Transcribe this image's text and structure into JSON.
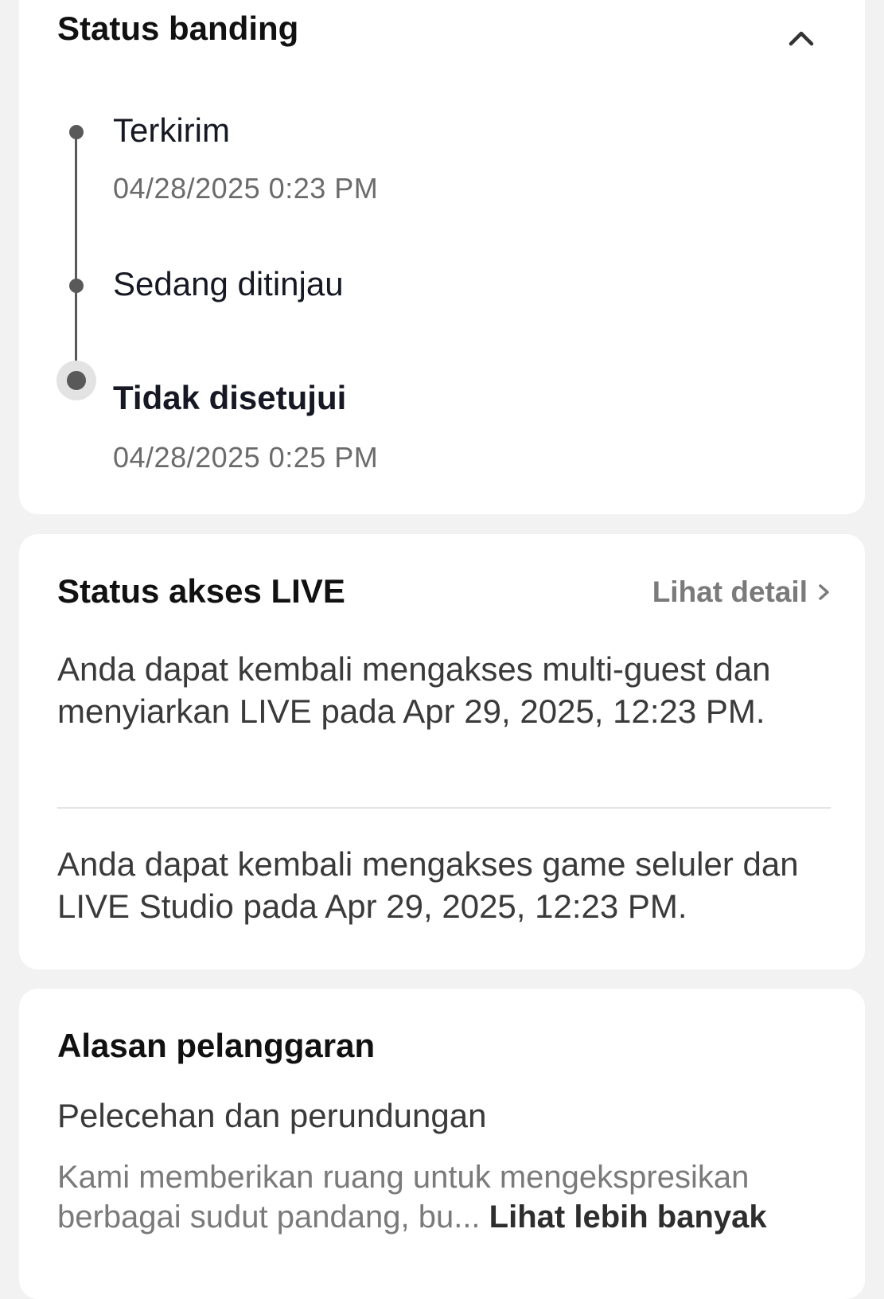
{
  "appeal_status": {
    "title": "Status banding",
    "collapse_icon": "chevron-up-icon",
    "steps": [
      {
        "label": "Terkirim",
        "time": "04/28/2025 0:23 PM"
      },
      {
        "label": "Sedang ditinjau",
        "time": ""
      },
      {
        "label": "Tidak disetujui",
        "time": "04/28/2025 0:25 PM",
        "active": true
      }
    ]
  },
  "live_access": {
    "title": "Status akses LIVE",
    "detail_link": "Lihat detail",
    "detail_icon": "chevron-right-icon",
    "messages": [
      "Anda dapat kembali mengakses multi-guest dan menyiarkan LIVE pada Apr 29, 2025, 12:23 PM.",
      "Anda dapat kembali mengakses game seluler dan LIVE Studio pada Apr 29, 2025, 12:23 PM."
    ]
  },
  "violation_reason": {
    "title": "Alasan pelanggaran",
    "reason": "Pelecehan dan perundungan",
    "description": "Kami memberikan ruang untuk mengekspresikan berbagai sudut pandang, bu...",
    "see_more": "Lihat lebih banyak"
  },
  "colors": {
    "background": "#f2f2f2",
    "card": "#ffffff",
    "timeline": "#595959",
    "muted_text": "#7a7a7a"
  }
}
